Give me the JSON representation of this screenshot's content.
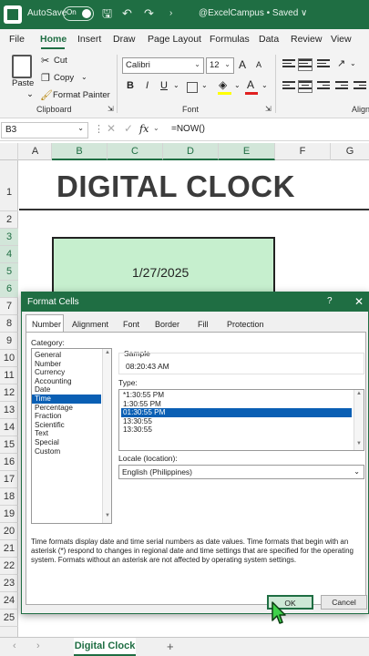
{
  "titlebar": {
    "autosave_label": "AutoSave",
    "autosave_state": "On",
    "doc_title": "@ExcelCampus • Saved ∨",
    "accent": "#1f6e43"
  },
  "ribbon_tabs": [
    "File",
    "Home",
    "Insert",
    "Draw",
    "Page Layout",
    "Formulas",
    "Data",
    "Review",
    "View"
  ],
  "ribbon": {
    "paste": "Paste",
    "cut": "Cut",
    "copy": "Copy",
    "format_painter": "Format Painter",
    "clipboard_label": "Clipboard",
    "font_name": "Calibri",
    "font_size": "12",
    "font_label": "Font",
    "align_label": "Align",
    "bold": "B",
    "italic": "I",
    "underline": "U",
    "font_color_glyph": "A",
    "grow_glyph": "A",
    "shrink_glyph": "A"
  },
  "formula_bar": {
    "name_box": "B3",
    "fx": "fx",
    "formula": "=NOW()"
  },
  "columns": [
    "A",
    "B",
    "C",
    "D",
    "E",
    "F",
    "G"
  ],
  "rows": [
    "1",
    "2",
    "3",
    "4",
    "5",
    "6",
    "7",
    "8",
    "9",
    "10",
    "11",
    "12",
    "13",
    "14",
    "15",
    "16",
    "17",
    "18",
    "19",
    "20",
    "21",
    "22",
    "23",
    "24",
    "25"
  ],
  "sheet": {
    "title": "DIGITAL CLOCK",
    "clock_date": "1/27/2025",
    "tab_name": "Digital Clock",
    "add_sheet": "+"
  },
  "dialog": {
    "title": "Format Cells",
    "help": "?",
    "close": "✕",
    "tabs": [
      "Number",
      "Alignment",
      "Font",
      "Border",
      "Fill",
      "Protection"
    ],
    "category_label": "Category:",
    "categories": [
      "General",
      "Number",
      "Currency",
      "Accounting",
      "Date",
      "Time",
      "Percentage",
      "Fraction",
      "Scientific",
      "Text",
      "Special",
      "Custom"
    ],
    "selected_category": "Time",
    "sample_label": "Sample",
    "sample_value": "08:20:43 AM",
    "type_label": "Type:",
    "types": [
      "*1:30:55 PM",
      "1:30:55 PM",
      "01:30:55 PM",
      "13:30:55",
      "13:30:55"
    ],
    "selected_type": "01:30:55 PM",
    "locale_label": "Locale (location):",
    "locale_value": "English (Philippines)",
    "description": "Time formats display date and time serial numbers as date values.  Time formats that begin with an asterisk (*) respond to changes in regional date and time settings that are specified for the operating system. Formats without an asterisk are not affected by operating system settings.",
    "ok": "OK",
    "cancel": "Cancel"
  }
}
